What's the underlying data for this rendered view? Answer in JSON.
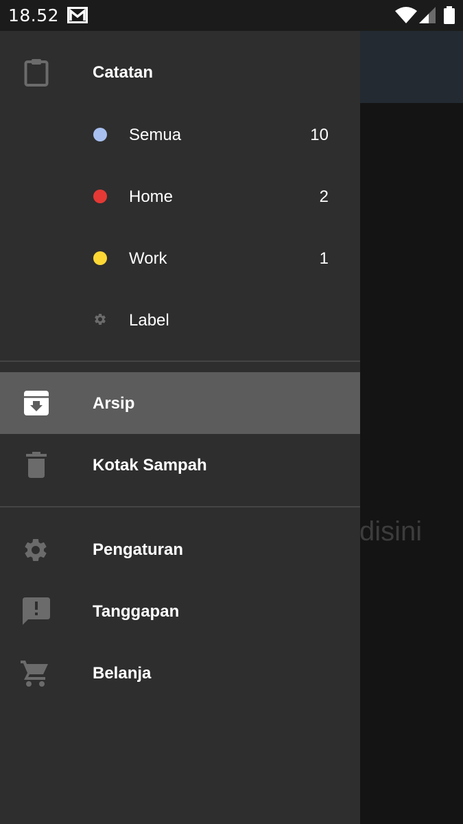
{
  "status_bar": {
    "time": "18.52",
    "notification_icon": "gmail-icon",
    "wifi_icon": "wifi-icon",
    "signal_icon": "signal-icon",
    "battery_icon": "battery-icon"
  },
  "background": {
    "partial_text": "disini"
  },
  "drawer": {
    "notes": {
      "label": "Catatan",
      "icon": "clipboard-icon"
    },
    "labels": [
      {
        "label": "Semua",
        "count": "10",
        "color": "#a8c0f0"
      },
      {
        "label": "Home",
        "count": "2",
        "color": "#e53935"
      },
      {
        "label": "Work",
        "count": "1",
        "color": "#fdd835"
      }
    ],
    "label_settings": {
      "label": "Label",
      "icon": "gear-icon"
    },
    "archive": {
      "label": "Arsip",
      "icon": "archive-icon",
      "selected": true
    },
    "trash": {
      "label": "Kotak Sampah",
      "icon": "trash-icon"
    },
    "settings": {
      "label": "Pengaturan",
      "icon": "gear-icon"
    },
    "feedback": {
      "label": "Tanggapan",
      "icon": "feedback-icon"
    },
    "shop": {
      "label": "Belanja",
      "icon": "cart-icon"
    }
  },
  "colors": {
    "drawer_bg": "#2e2e2e",
    "selected_bg": "#5c5c5c",
    "icon_gray": "#6b6b6b",
    "app_bar": "#232a31"
  }
}
